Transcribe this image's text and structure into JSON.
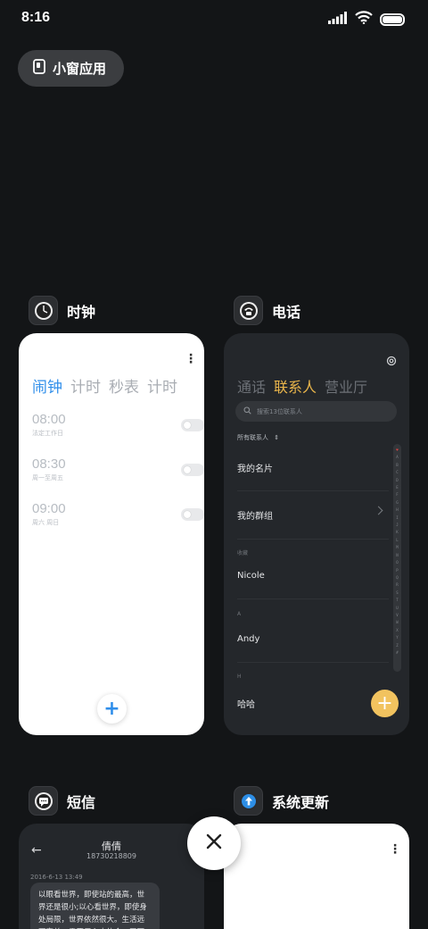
{
  "status_bar": {
    "time": "8:16"
  },
  "floating_button": {
    "label": "小窗应用"
  },
  "clock_app": {
    "name": "时钟",
    "tabs": [
      "闹钟",
      "计时",
      "秒表",
      "计时"
    ],
    "active_tab": 0,
    "alarms": [
      {
        "time": "08:00",
        "repeat": "法定工作日",
        "enabled": false
      },
      {
        "time": "08:30",
        "repeat": "周一至周五",
        "enabled": false
      },
      {
        "time": "09:00",
        "repeat": "周六 周日",
        "enabled": false
      }
    ],
    "add_label": "+"
  },
  "phone_app": {
    "name": "电话",
    "tabs": [
      "通话",
      "联系人",
      "营业厅"
    ],
    "active_tab": 1,
    "search_placeholder": "搜索13位联系人",
    "filter_label": "所有联系人",
    "my_card": "我的名片",
    "my_groups": "我的群组",
    "section_favorites": "收藏",
    "favorite_contact": "Nicole",
    "section_a": "A",
    "contact_a": "Andy",
    "section_h": "H",
    "contact_h": "哈哈",
    "alphabet": [
      "♥",
      "A",
      "B",
      "C",
      "D",
      "E",
      "F",
      "G",
      "H",
      "I",
      "J",
      "K",
      "L",
      "M",
      "N",
      "O",
      "P",
      "Q",
      "R",
      "S",
      "T",
      "U",
      "V",
      "W",
      "X",
      "Y",
      "Z",
      "#"
    ],
    "add_label": "+"
  },
  "sms_app": {
    "name": "短信",
    "contact_name": "倩倩",
    "contact_number": "18730218809",
    "date": "2016-6-13 13:49",
    "message": "以眼看世界，即使站的最高，世界还是很小;以心看世界，即使身处局限，世界依然很大。生活远不完美，需要用心去体会，天下幸福"
  },
  "update_app": {
    "name": "系统更新"
  },
  "colors": {
    "background": "#131517",
    "clock_accent": "#2f8eea",
    "phone_accent": "#e9b54b"
  }
}
